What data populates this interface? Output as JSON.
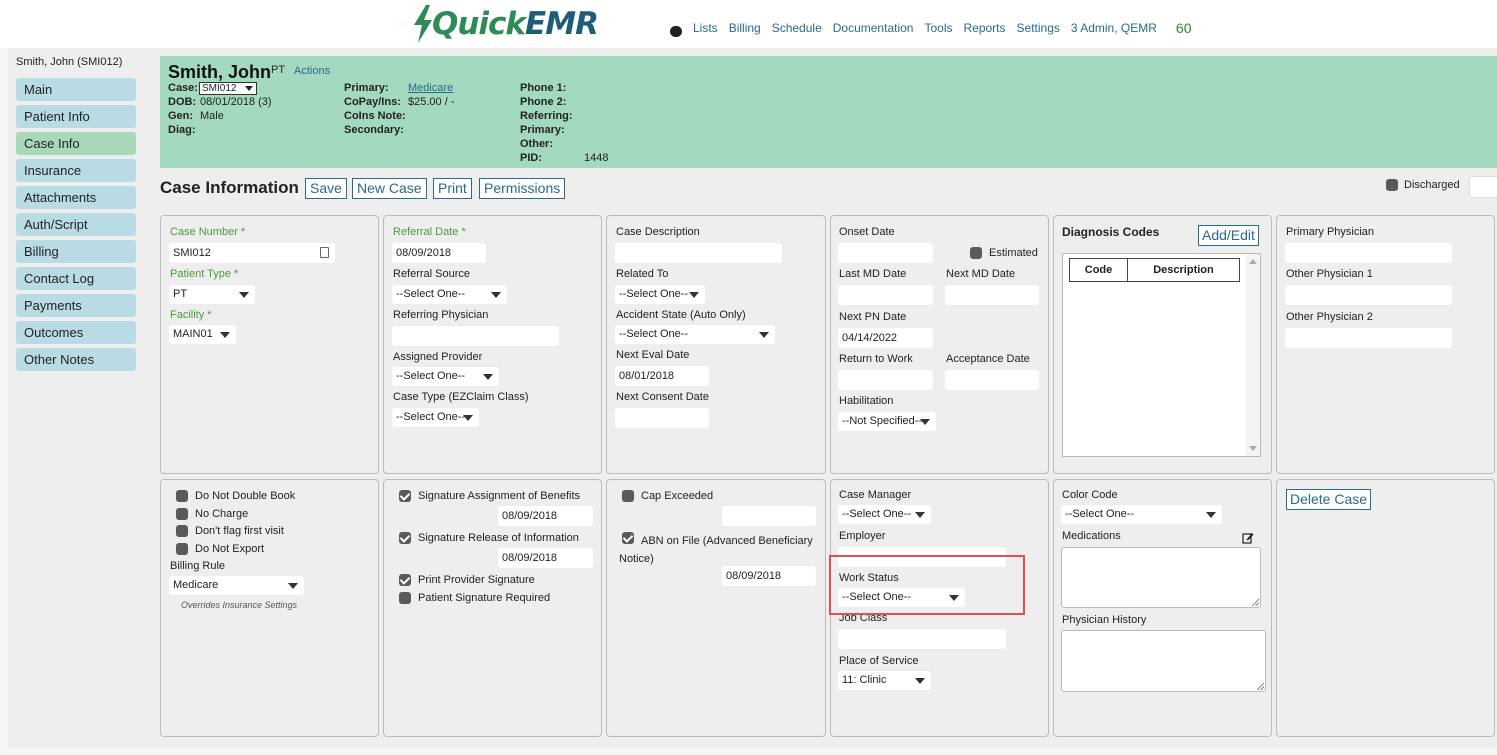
{
  "header": {
    "logo_text_1": "Quick",
    "logo_text_2": "EMR",
    "nav": [
      "Lists",
      "Billing",
      "Schedule",
      "Documentation",
      "Tools",
      "Reports",
      "Settings",
      "3 Admin, QEMR"
    ],
    "count": "60"
  },
  "sidebar": {
    "patient": "Smith, John (SMI012)",
    "items": [
      "Main",
      "Patient Info",
      "Case Info",
      "Insurance",
      "Attachments",
      "Auth/Script",
      "Billing",
      "Contact Log",
      "Payments",
      "Outcomes",
      "Other Notes"
    ],
    "active": "Case Info"
  },
  "banner": {
    "name": "Smith, John",
    "discipline": "PT",
    "actions": "Actions",
    "labels": {
      "case": "Case:",
      "dob": "DOB:",
      "gen": "Gen:",
      "diag": "Diag:",
      "primary": "Primary:",
      "copay": "CoPay/Ins:",
      "coins": "CoIns Note:",
      "secondary": "Secondary:",
      "phone1": "Phone 1:",
      "phone2": "Phone 2:",
      "referring": "Referring:",
      "primary2": "Primary:",
      "other": "Other:",
      "pid": "PID:"
    },
    "values": {
      "case": "SMI012",
      "dob": "08/01/2018 (3)",
      "gen": "Male",
      "primary": "Medicare",
      "copay": "$25.00 / -",
      "pid": "1448"
    }
  },
  "toolbar": {
    "title": "Case Information",
    "save": "Save",
    "new_case": "New Case",
    "print": "Print",
    "permissions": "Permissions",
    "discharged": "Discharged"
  },
  "p1": {
    "case_number_label": "Case Number *",
    "case_number": "SMI012",
    "patient_type_label": "Patient Type *",
    "patient_type": "PT",
    "facility_label": "Facility *",
    "facility": "MAIN01"
  },
  "p2": {
    "referral_date_label": "Referral Date *",
    "referral_date": "08/09/2018",
    "referral_source_label": "Referral Source",
    "referral_source": "--Select One--",
    "referring_physician_label": "Referring Physician",
    "assigned_provider_label": "Assigned Provider",
    "assigned_provider": "--Select One--",
    "case_type_label": "Case Type (EZClaim Class)",
    "case_type": "--Select One--"
  },
  "p3": {
    "case_description_label": "Case Description",
    "related_to_label": "Related To",
    "related_to": "--Select One--",
    "accident_state_label": "Accident State (Auto Only)",
    "accident_state": "--Select One--",
    "next_eval_label": "Next Eval Date",
    "next_eval": "08/01/2018",
    "next_consent_label": "Next Consent Date"
  },
  "p4": {
    "onset_label": "Onset Date",
    "estimated": "Estimated",
    "last_md_label": "Last MD Date",
    "next_md_label": "Next MD Date",
    "next_pn_label": "Next PN Date",
    "next_pn": "04/14/2022",
    "return_work_label": "Return to Work",
    "acceptance_label": "Acceptance Date",
    "habilitation_label": "Habilitation",
    "habilitation": "--Not Specified--"
  },
  "p5": {
    "title": "Diagnosis Codes",
    "add_edit": "Add/Edit",
    "col_code": "Code",
    "col_desc": "Description"
  },
  "p6": {
    "primary_physician_label": "Primary Physician",
    "other1_label": "Other Physician 1",
    "other2_label": "Other Physician 2"
  },
  "p7": {
    "do_not_double_book": "Do Not Double Book",
    "no_charge": "No Charge",
    "dont_flag": "Don't flag first visit",
    "do_not_export": "Do Not Export",
    "billing_rule_label": "Billing Rule",
    "billing_rule": "Medicare",
    "overrides": "Overrides Insurance Settings"
  },
  "p8": {
    "sig_benefits": "Signature Assignment of Benefits",
    "sig_benefits_date": "08/09/2018",
    "sig_release": "Signature Release of Information",
    "sig_release_date": "08/09/2018",
    "print_provider": "Print Provider Signature",
    "patient_sig": "Patient Signature Required"
  },
  "p9": {
    "cap_exceeded": "Cap Exceeded",
    "abn": "ABN on File (Advanced Beneficiary Notice)",
    "abn_date": "08/09/2018"
  },
  "p10": {
    "case_manager_label": "Case Manager",
    "case_manager": "--Select One--",
    "employer_label": "Employer",
    "work_status_label": "Work Status",
    "work_status": "--Select One--",
    "job_class_label": "Job Class",
    "place_of_service_label": "Place of Service",
    "place_of_service": "11: Clinic"
  },
  "p11": {
    "color_code_label": "Color Code",
    "color_code": "--Select One--",
    "medications_label": "Medications",
    "physician_history_label": "Physician History"
  },
  "p12": {
    "delete_case": "Delete Case"
  },
  "colors": {
    "banner": "#a3d9bf",
    "sidebar_item": "#b9dbe4",
    "sidebar_active": "#a6d8b9",
    "link": "#2a6a8a",
    "required": "#4a9a3a",
    "highlight": "#e05050"
  }
}
